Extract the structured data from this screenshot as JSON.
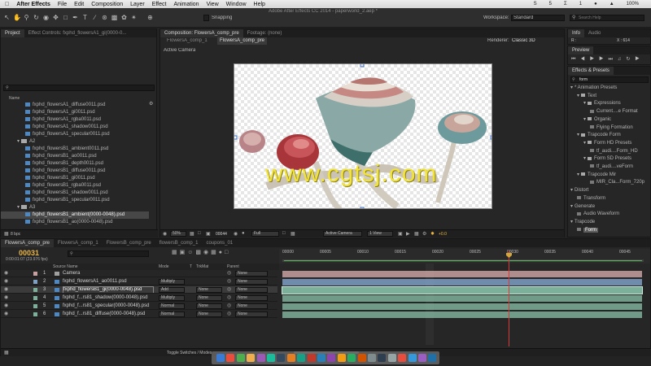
{
  "menubar": {
    "app": "After Effects",
    "items": [
      "File",
      "Edit",
      "Composition",
      "Layer",
      "Effect",
      "Animation",
      "View",
      "Window",
      "Help"
    ],
    "right": [
      "S",
      "5",
      "Σ",
      "1",
      "●",
      "•",
      "▲",
      "100%",
      "✦"
    ]
  },
  "toolbar": {
    "title": "Adobe After Effects CC 2014 - paperworld_2.aep *",
    "snapping": "Snapping",
    "workspace_label": "Workspace:",
    "workspace_value": "Standard",
    "search_placeholder": "Search Help"
  },
  "project": {
    "tabs": [
      "Project",
      "Effect Controls: fxphd_flowersA1_gi(0000-0..."
    ],
    "search_placeholder": "",
    "column_name": "Name",
    "items": [
      {
        "type": "file",
        "name": "fxphd_flowersA1_diffuse0011.psd",
        "indent": 3
      },
      {
        "type": "file",
        "name": "fxphd_flowersA1_gi0011.psd",
        "indent": 3
      },
      {
        "type": "file",
        "name": "fxphd_flowersA1_rgba0011.psd",
        "indent": 3
      },
      {
        "type": "file",
        "name": "fxphd_flowersA1_shadow0011.psd",
        "indent": 3
      },
      {
        "type": "file",
        "name": "fxphd_flowersA1_specular0011.psd",
        "indent": 3
      },
      {
        "type": "folder",
        "name": "A2",
        "indent": 2
      },
      {
        "type": "file",
        "name": "fxphd_flowersB1_ambient0011.psd",
        "indent": 3
      },
      {
        "type": "file",
        "name": "fxphd_flowersB1_ao0011.psd",
        "indent": 3
      },
      {
        "type": "file",
        "name": "fxphd_flowersB1_depth0011.psd",
        "indent": 3
      },
      {
        "type": "file",
        "name": "fxphd_flowersB1_diffuse0011.psd",
        "indent": 3
      },
      {
        "type": "file",
        "name": "fxphd_flowersB1_gi0011.psd",
        "indent": 3
      },
      {
        "type": "file",
        "name": "fxphd_flowersB1_rgba0011.psd",
        "indent": 3
      },
      {
        "type": "file",
        "name": "fxphd_flowersB1_shadow0011.psd",
        "indent": 3
      },
      {
        "type": "file",
        "name": "fxphd_flowersB1_specular0011.psd",
        "indent": 3
      },
      {
        "type": "folder",
        "name": "A3",
        "indent": 2
      },
      {
        "type": "file",
        "name": "fxphd_flowersB1_ambient(0000-0048).psd",
        "indent": 3,
        "selected": true
      },
      {
        "type": "file",
        "name": "fxphd_flowersB1_ao(0000-0048).psd",
        "indent": 3
      }
    ],
    "bpc": "8 bpc"
  },
  "composition": {
    "tabs": [
      "Composition: FlowersA_comp_pre",
      "Footage: (none)"
    ],
    "subtabs": [
      "FlowersA_comp_1",
      "FlowersA_comp_pre"
    ],
    "renderer_label": "Renderer:",
    "renderer_value": "Classic 3D",
    "view_label": "Active Camera",
    "watermark": "www.cgtsj.com",
    "footer": {
      "zoom": "50%",
      "timecode": "00044",
      "resolution": "Full",
      "camera": "Active Camera",
      "views": "1 View",
      "exposure": "+0.0"
    }
  },
  "info": {
    "tabs": [
      "Info",
      "Audio"
    ],
    "r_label": "R :",
    "x_label": "X : 614",
    "y_label": "Y :",
    "r_value": "",
    "y_value": ""
  },
  "preview": {
    "tab": "Preview"
  },
  "effects": {
    "tab": "Effects & Presets",
    "search_value": "form",
    "items": [
      {
        "label": "* Animation Presets",
        "indent": 0,
        "caret": "▾"
      },
      {
        "label": "Text",
        "indent": 1,
        "caret": "▾",
        "folder": true
      },
      {
        "label": "Expressions",
        "indent": 2,
        "caret": "▾",
        "folder": true
      },
      {
        "label": "Current....e Format",
        "indent": 3,
        "file": true
      },
      {
        "label": "Organic",
        "indent": 2,
        "caret": "▾",
        "folder": true
      },
      {
        "label": "Flying Formation",
        "indent": 3,
        "file": true
      },
      {
        "label": "Trapcode Form",
        "indent": 1,
        "caret": "▾",
        "folder": true
      },
      {
        "label": "Form HD Presets",
        "indent": 2,
        "caret": "▾",
        "folder": true
      },
      {
        "label": "tf_audi....Form_HD",
        "indent": 3,
        "file": true
      },
      {
        "label": "Form SD Presets",
        "indent": 2,
        "caret": "▾",
        "folder": true
      },
      {
        "label": "tf_audi....veForm",
        "indent": 3,
        "file": true
      },
      {
        "label": "Trapcode Mir",
        "indent": 1,
        "caret": "▾",
        "folder": true
      },
      {
        "label": "MIR_Cla...Form_720p",
        "indent": 3,
        "file": true
      },
      {
        "label": "Distort",
        "indent": 0,
        "caret": "▾"
      },
      {
        "label": "Transform",
        "indent": 1,
        "file": true
      },
      {
        "label": "Generate",
        "indent": 0,
        "caret": "▾"
      },
      {
        "label": "Audio Waveform",
        "indent": 1,
        "file": true
      },
      {
        "label": "Trapcode",
        "indent": 0,
        "caret": "▾"
      },
      {
        "label": "Form",
        "indent": 1,
        "file": true,
        "selected": true
      }
    ]
  },
  "timeline": {
    "tabs": [
      "FlowersA_comp_pre",
      "FlowersA_comp_1",
      "FlowersB_comp_pre",
      "flowersB_comp_1",
      "coupons_01"
    ],
    "timecode": "00031",
    "timecode_sub": "0:00:01:07 (23.976 fps)",
    "columns": {
      "source": "Source Name",
      "mode": "Mode",
      "t": "T",
      "trkmat": "TrkMat",
      "parent": "Parent"
    },
    "layers": [
      {
        "num": "1",
        "name": "Camera",
        "mode": "",
        "trkmat": "",
        "parent": "None",
        "color": "#c8a0a0"
      },
      {
        "num": "2",
        "name": "fxphd_flowersA1_ao0011.psd",
        "mode": "Multiply",
        "trkmat": "",
        "parent": "None",
        "color": "#7d9fc4"
      },
      {
        "num": "3",
        "name": "fxphd_flowersB1_gi(0000-0048).psd",
        "mode": "Add",
        "trkmat": "None",
        "parent": "None",
        "color": "#7db09a",
        "selected": true
      },
      {
        "num": "4",
        "name": "fxphd_f...rs81_shadow(0000-0048).psd",
        "mode": "Multiply",
        "trkmat": "None",
        "parent": "None",
        "color": "#7db09a"
      },
      {
        "num": "5",
        "name": "fxphd_f...rs81_specular(0000-0048).psd",
        "mode": "Normal",
        "trkmat": "None",
        "parent": "None",
        "color": "#7db09a"
      },
      {
        "num": "6",
        "name": "fxphd_f...rs81_diffuse(0000-0048).psd",
        "mode": "Normal",
        "trkmat": "None",
        "parent": "None",
        "color": "#7db09a"
      }
    ],
    "ruler": [
      "00000",
      "00005",
      "00010",
      "00015",
      "00020",
      "00025",
      "00030",
      "00035",
      "00040",
      "00045"
    ],
    "toggle_label": "Toggle Switches / Modes"
  },
  "colors": {
    "accent_blue": "#4b88c4",
    "layer_green": "#7db09a",
    "layer_pink": "#c8a0a0",
    "layer_blue": "#7d9fc4",
    "playhead": "#d43b3b",
    "watermark": "#f2e33b"
  }
}
